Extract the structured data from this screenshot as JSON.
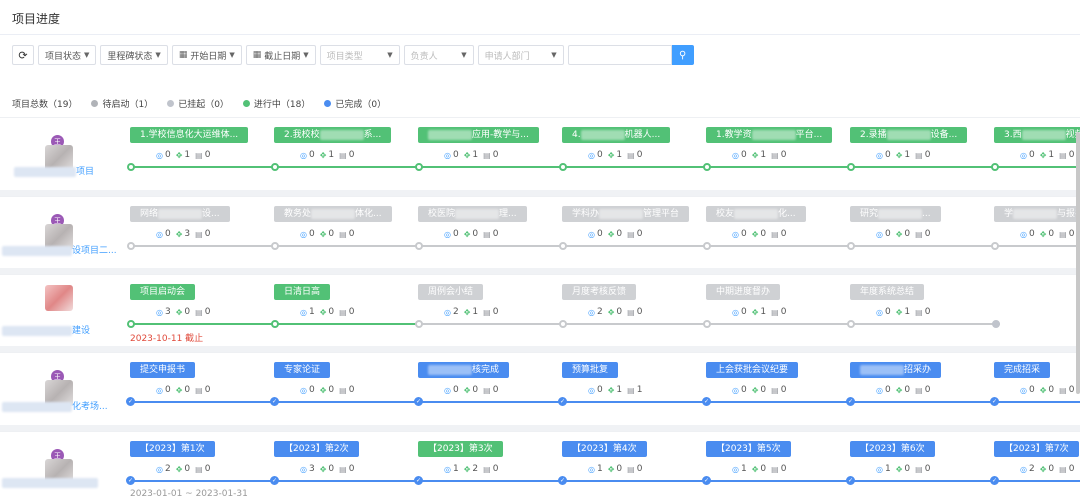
{
  "page_title": "项目进度",
  "toolbar": {
    "refresh_icon": "refresh-icon",
    "project_status": "项目状态",
    "milestone_status": "里程碑状态",
    "start_date": "开始日期",
    "end_date": "截止日期",
    "project_type_placeholder": "项目类型",
    "owner_placeholder": "负责人",
    "department_placeholder": "申请人部门",
    "search_value": ""
  },
  "legend": {
    "total": "项目总数（19）",
    "pending": "待启动（1）",
    "suspended": "已挂起（0）",
    "in_progress": "进行中（18）",
    "done": "已完成（0）"
  },
  "colors": {
    "green": "#52c176",
    "gray": "#c0c4cc",
    "blue": "#4a8cf0",
    "primary": "#409eff"
  },
  "rows": [
    {
      "badge": "王",
      "name_suffix": "项目",
      "steps": [
        {
          "label": "1.学校信息化大运维体...",
          "stats": [
            "0",
            "1",
            "0"
          ]
        },
        {
          "label": "2.我校校",
          "tail": "系...",
          "stats": [
            "0",
            "1",
            "0"
          ]
        },
        {
          "label": "",
          "tail": "应用-教学与...",
          "stats": [
            "0",
            "1",
            "0"
          ]
        },
        {
          "label": "4.",
          "tail": "机器人...",
          "stats": [
            "0",
            "1",
            "0"
          ]
        },
        {
          "label": "1.教学资",
          "tail": "平台...",
          "stats": [
            "0",
            "1",
            "0"
          ]
        },
        {
          "label": "2.录播",
          "tail": "设备...",
          "stats": [
            "0",
            "1",
            "0"
          ]
        },
        {
          "label": "3.西",
          "tail": "视频",
          "stats": [
            "0",
            "1",
            "0"
          ]
        }
      ]
    },
    {
      "badge": "王",
      "name_suffix": "设项目二...",
      "steps": [
        {
          "label": "网络",
          "tail": "设...",
          "stats": [
            "0",
            "3",
            "0"
          ]
        },
        {
          "label": "教务处",
          "tail": "体化...",
          "stats": [
            "0",
            "0",
            "0"
          ]
        },
        {
          "label": "校医院",
          "tail": "理...",
          "stats": [
            "0",
            "0",
            "0"
          ]
        },
        {
          "label": "学科办",
          "tail": "管理平台",
          "stats": [
            "0",
            "0",
            "0"
          ]
        },
        {
          "label": "校友",
          "tail": "化...",
          "stats": [
            "0",
            "0",
            "0"
          ]
        },
        {
          "label": "研究",
          "tail": "...",
          "stats": [
            "0",
            "0",
            "0"
          ]
        },
        {
          "label": "学",
          "tail": "与报名",
          "stats": [
            "0",
            "0",
            "0"
          ]
        }
      ]
    },
    {
      "name_suffix": "建设",
      "note": "2023-10-11 截止",
      "steps": [
        {
          "label": "项目启动会",
          "stats": [
            "3",
            "0",
            "0"
          ]
        },
        {
          "label": "日清日高",
          "stats": [
            "1",
            "0",
            "0"
          ]
        },
        {
          "label": "周例会小结",
          "stats": [
            "2",
            "1",
            "0"
          ]
        },
        {
          "label": "月度考核反馈",
          "stats": [
            "2",
            "0",
            "0"
          ]
        },
        {
          "label": "中期进度督办",
          "stats": [
            "0",
            "1",
            "0"
          ]
        },
        {
          "label": "年度系统总结",
          "stats": [
            "0",
            "1",
            "0"
          ]
        }
      ]
    },
    {
      "badge": "王",
      "name_suffix": "化考场...",
      "steps": [
        {
          "label": "提交申报书",
          "stats": [
            "0",
            "0",
            "0"
          ]
        },
        {
          "label": "专家论证",
          "stats": [
            "0",
            "0",
            "0"
          ]
        },
        {
          "label": "",
          "tail": "核完成",
          "stats": [
            "0",
            "0",
            "0"
          ]
        },
        {
          "label": "预算批复",
          "stats": [
            "0",
            "1",
            "1"
          ]
        },
        {
          "label": "上会获批会议纪要",
          "stats": [
            "0",
            "0",
            "0"
          ]
        },
        {
          "label": "",
          "tail": "招采办",
          "stats": [
            "0",
            "0",
            "0"
          ]
        },
        {
          "label": "完成招采",
          "stats": [
            "0",
            "0",
            "0"
          ]
        }
      ]
    },
    {
      "badge": "王",
      "note": "2023-01-01 ~ 2023-01-31",
      "steps": [
        {
          "label": "【2023】第1次",
          "stats": [
            "2",
            "0",
            "0"
          ]
        },
        {
          "label": "【2023】第2次",
          "stats": [
            "3",
            "0",
            "0"
          ]
        },
        {
          "label": "【2023】第3次",
          "stats": [
            "1",
            "2",
            "0"
          ]
        },
        {
          "label": "【2023】第4次",
          "stats": [
            "1",
            "0",
            "0"
          ]
        },
        {
          "label": "【2023】第5次",
          "stats": [
            "1",
            "0",
            "0"
          ]
        },
        {
          "label": "【2023】第6次",
          "stats": [
            "1",
            "0",
            "0"
          ]
        },
        {
          "label": "【2023】第7次",
          "stats": [
            "2",
            "0",
            "0"
          ]
        }
      ]
    }
  ]
}
